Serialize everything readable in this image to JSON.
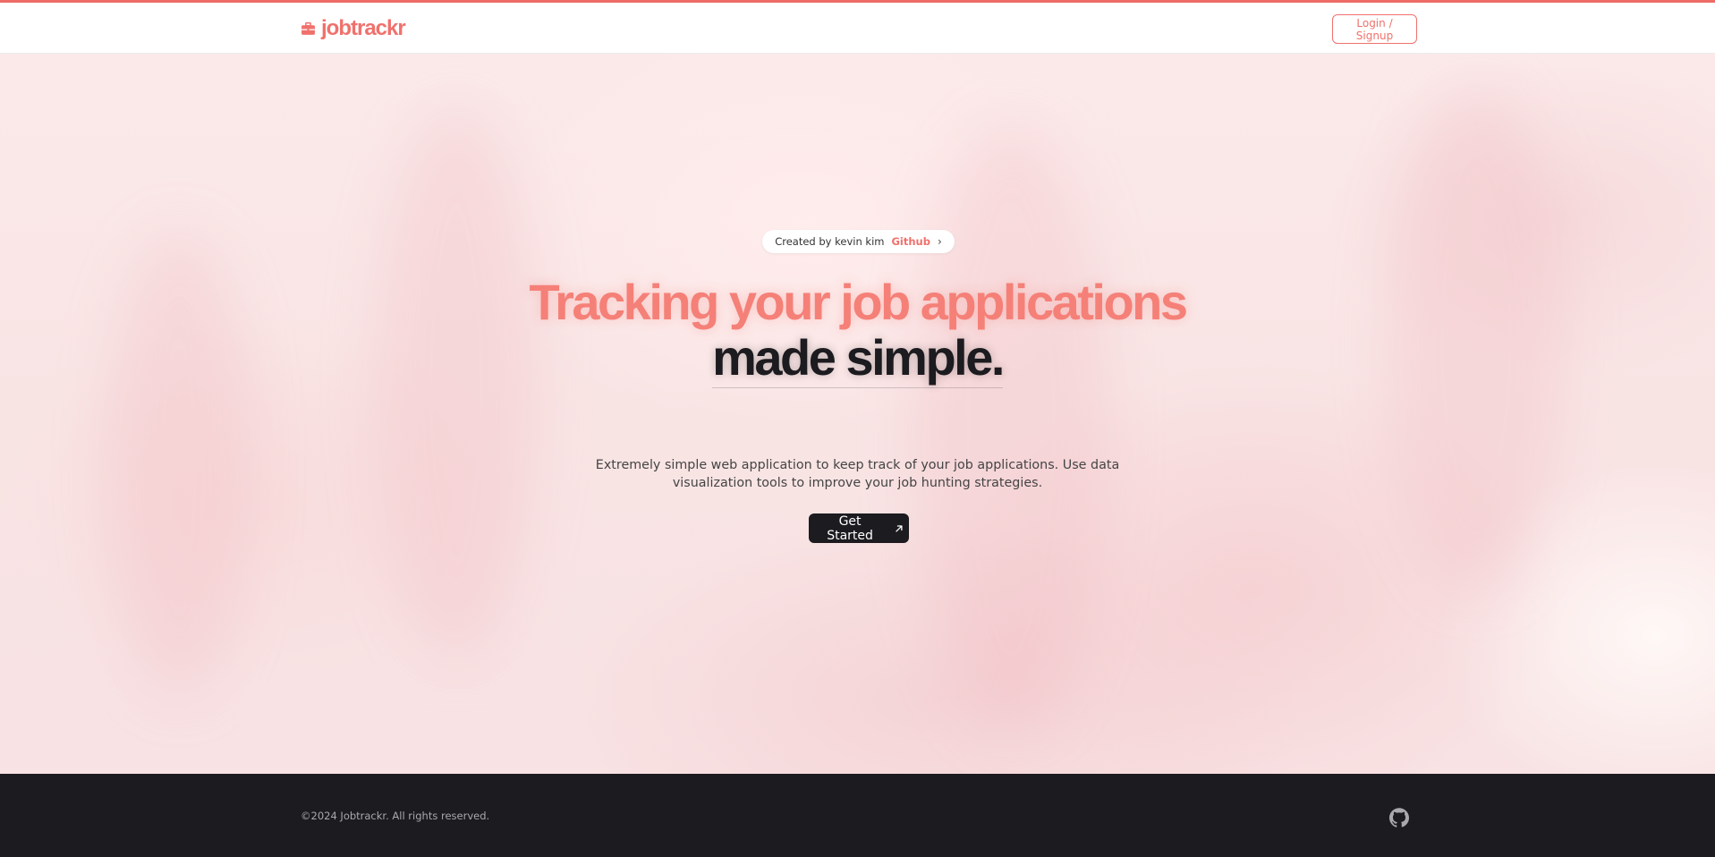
{
  "header": {
    "brand": "jobtrackr",
    "login_label": "Login / Signup"
  },
  "hero": {
    "creator_text": "Created by kevin kim",
    "github_link": "Github",
    "headline_line1": "Tracking your job applications",
    "headline_line2": "made simple.",
    "subtitle": "Extremely simple web application to keep track of your job applications. Use data visualization tools to improve your job hunting strategies.",
    "cta_label": "Get Started"
  },
  "footer": {
    "copyright": "©2024 Jobtrackr. All rights reserved."
  },
  "icons": {
    "brand": "briefcase-icon",
    "pill_chevron": "chevron-right-icon",
    "cta_arrow": "arrow-up-right-icon",
    "footer_link": "github-icon"
  },
  "colors": {
    "accent": "#f0716c",
    "dark": "#1c1b1f",
    "top_accent": "#ee6b66"
  }
}
